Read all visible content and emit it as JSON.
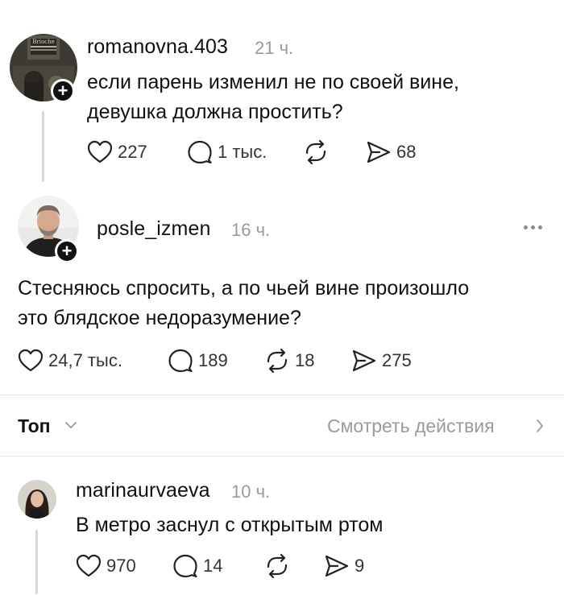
{
  "posts": [
    {
      "username": "romanovna.403",
      "time": "21 ч.",
      "text_lines": [
        "если парень изменил не по своей вине,",
        "девушка должна простить?"
      ],
      "likes": "227",
      "comments": "1 тыс.",
      "reposts": "",
      "shares": "68",
      "avatar_label": "Brioche"
    },
    {
      "username": "posle_izmen",
      "time": "16 ч.",
      "text_lines": [
        "Стесняюсь спросить, а по чьей вине произошло",
        "это блядское недоразумение?"
      ],
      "likes": "24,7 тыс.",
      "comments": "189",
      "reposts": "18",
      "shares": "275"
    }
  ],
  "sort_bar": {
    "sort_label": "Топ",
    "activity_label": "Смотреть действия"
  },
  "reply": {
    "username": "marinaurvaeva",
    "time": "10 ч.",
    "text": "В метро заснул с открытым ртом",
    "likes": "970",
    "comments": "14",
    "reposts": "",
    "shares": "9"
  },
  "colors": {
    "text": "#111111",
    "muted": "#9a9a9a",
    "divider": "#e6e6e6",
    "thread_line": "#d9d9d9"
  },
  "icons": [
    "heart-icon",
    "comment-icon",
    "repost-icon",
    "share-icon",
    "plus-icon",
    "more-icon",
    "chevron-down-icon",
    "chevron-right-icon"
  ]
}
